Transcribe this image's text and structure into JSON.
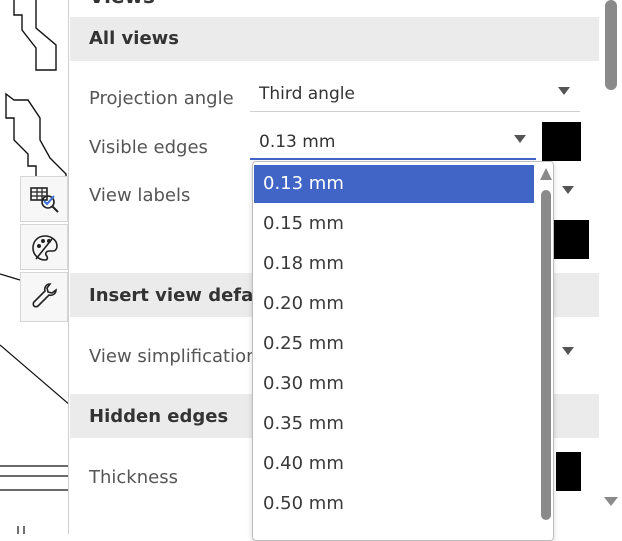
{
  "panel": {
    "top_title": "Views",
    "sections": {
      "all_views": "All views",
      "insert_view_defaults": "Insert view defaults",
      "hidden_edges": "Hidden edges"
    },
    "fields": {
      "projection_angle": {
        "label": "Projection angle",
        "value": "Third angle"
      },
      "visible_edges": {
        "label": "Visible edges",
        "value": "0.13 mm",
        "color": "#000000"
      },
      "view_labels": {
        "label": "View labels"
      },
      "view_simplification": {
        "label": "View simplification"
      },
      "thickness": {
        "label": "Thickness"
      }
    }
  },
  "dropdown": {
    "options": [
      "0.13 mm",
      "0.15 mm",
      "0.18 mm",
      "0.20 mm",
      "0.25 mm",
      "0.30 mm",
      "0.35 mm",
      "0.40 mm",
      "0.50 mm"
    ],
    "selected": "0.13 mm"
  },
  "toolbar": {
    "icons": [
      "table-check-icon",
      "palette-icon",
      "wrench-icon"
    ]
  },
  "colors": {
    "selected_option": "#4065c7",
    "section_header_bg": "#ebebeb",
    "swatch": "#000000"
  }
}
